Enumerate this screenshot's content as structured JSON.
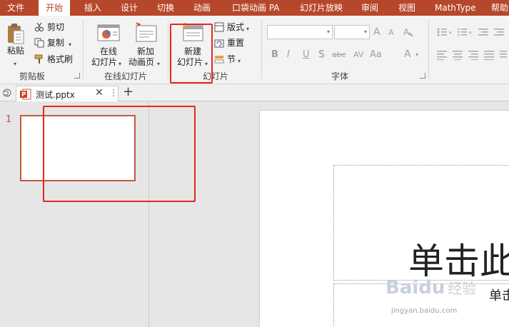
{
  "menu": {
    "tabs": [
      "文件",
      "开始",
      "插入",
      "设计",
      "切换",
      "动画",
      "口袋动画 PA",
      "幻灯片放映",
      "审阅",
      "视图",
      "MathType",
      "帮助"
    ],
    "active_tab": "开始"
  },
  "clipboard": {
    "paste": "粘贴",
    "cut": "剪切",
    "copy": "复制",
    "format_painter": "格式刷",
    "label": "剪贴板"
  },
  "online_slides": {
    "online_line1": "在线",
    "online_line2": "幻灯片",
    "new_anim_line1": "新加",
    "new_anim_line2": "动画页",
    "label": "在线幻灯片"
  },
  "slides": {
    "new_line1": "新建",
    "new_line2": "幻灯片",
    "layout": "版式",
    "reset": "重置",
    "section": "节",
    "label": "幻灯片"
  },
  "font": {
    "label": "字体",
    "bold": "B",
    "italic": "I",
    "underline": "U",
    "shadow": "S",
    "strike": "abc",
    "spacing": "AV",
    "case": "Aa",
    "color": "A",
    "grow": "A",
    "shrink": "A"
  },
  "document": {
    "tab_title": "测试.pptx",
    "add_tab": "+"
  },
  "thumbnail": {
    "slide_number": "1"
  },
  "slide": {
    "title_text": "单击此",
    "subtitle_text": "单击"
  },
  "watermark": {
    "brand": "Baidu",
    "suffix": "经验",
    "url": "jingyan.baidu.com"
  },
  "colors": {
    "accent": "#b7472a",
    "highlight": "#e8261f"
  }
}
